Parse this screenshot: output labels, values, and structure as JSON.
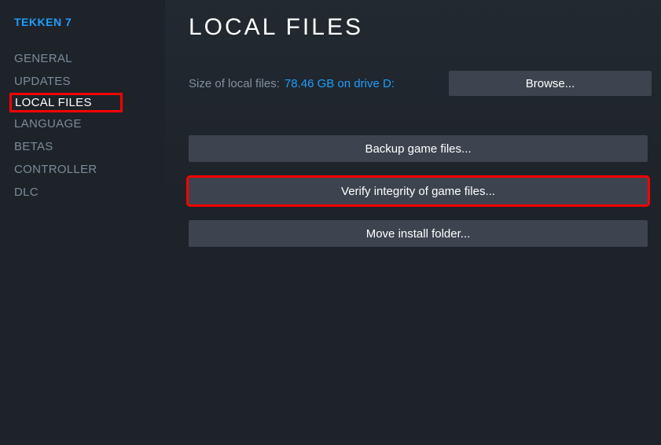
{
  "sidebar": {
    "game_title": "TEKKEN 7",
    "items": [
      {
        "label": "GENERAL"
      },
      {
        "label": "UPDATES"
      },
      {
        "label": "LOCAL FILES"
      },
      {
        "label": "LANGUAGE"
      },
      {
        "label": "BETAS"
      },
      {
        "label": "CONTROLLER"
      },
      {
        "label": "DLC"
      }
    ]
  },
  "main": {
    "title": "LOCAL FILES",
    "size_label": "Size of local files:",
    "size_value": "78.46 GB on drive D:",
    "browse_label": "Browse...",
    "backup_label": "Backup game files...",
    "verify_label": "Verify integrity of game files...",
    "move_label": "Move install folder..."
  }
}
